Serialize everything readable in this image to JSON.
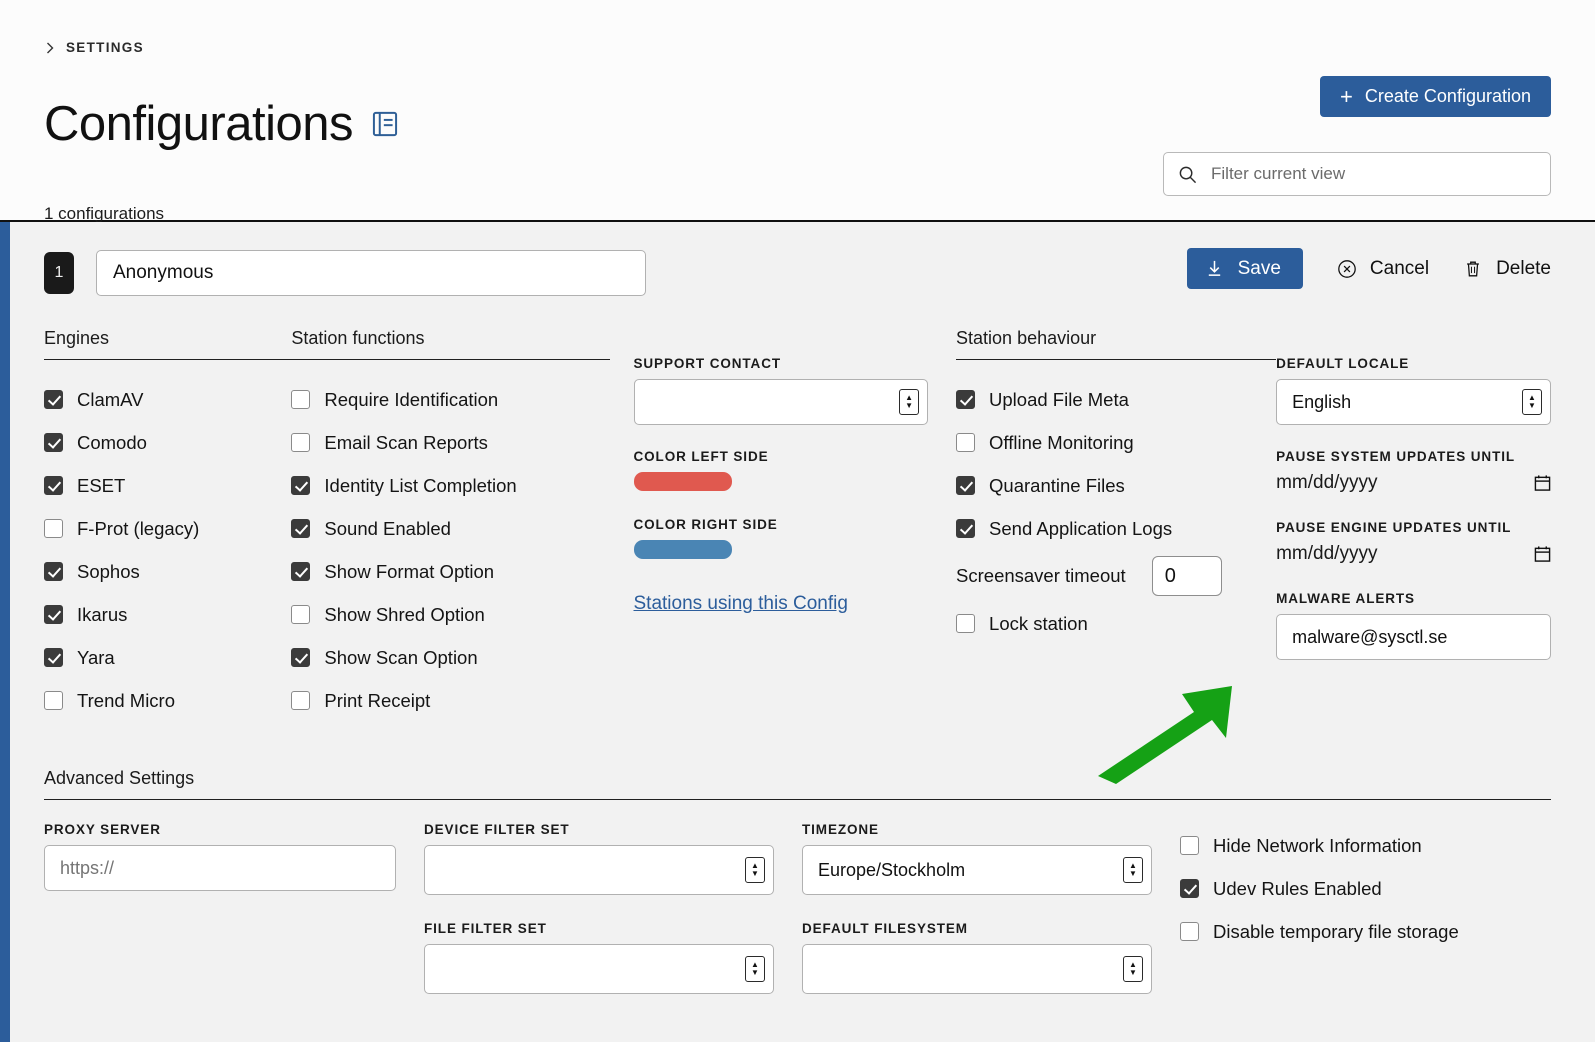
{
  "header": {
    "breadcrumb": "SETTINGS",
    "title": "Configurations",
    "title_icon": "book-icon",
    "subtitle": "1 configurations",
    "create_button": "Create Configuration",
    "create_icon": "plus-icon",
    "filter_placeholder": "Filter current view",
    "filter_value": "",
    "search_icon": "search-icon",
    "accent_color": "#2c5d9b"
  },
  "config": {
    "index": "1",
    "name": "Anonymous",
    "save_label": "Save",
    "save_icon": "download-icon",
    "cancel_label": "Cancel",
    "cancel_icon": "circle-x-icon",
    "delete_label": "Delete",
    "delete_icon": "trash-icon"
  },
  "engines": {
    "heading": "Engines",
    "items": [
      {
        "label": "ClamAV",
        "checked": true
      },
      {
        "label": "Comodo",
        "checked": true
      },
      {
        "label": "ESET",
        "checked": true
      },
      {
        "label": "F-Prot (legacy)",
        "checked": false
      },
      {
        "label": "Sophos",
        "checked": true
      },
      {
        "label": "Ikarus",
        "checked": true
      },
      {
        "label": "Yara",
        "checked": true
      },
      {
        "label": "Trend Micro",
        "checked": false
      }
    ]
  },
  "station_functions": {
    "heading": "Station functions",
    "items": [
      {
        "label": "Require Identification",
        "checked": false
      },
      {
        "label": "Email Scan Reports",
        "checked": false
      },
      {
        "label": "Identity List Completion",
        "checked": true
      },
      {
        "label": "Sound Enabled",
        "checked": true
      },
      {
        "label": "Show Format Option",
        "checked": true
      },
      {
        "label": "Show Shred Option",
        "checked": false
      },
      {
        "label": "Show Scan Option",
        "checked": true
      },
      {
        "label": "Print Receipt",
        "checked": false
      }
    ]
  },
  "support": {
    "contact_label": "SUPPORT CONTACT",
    "contact_value": "",
    "color_left_label": "COLOR LEFT SIDE",
    "color_left_value": "#e0594f",
    "color_right_label": "COLOR RIGHT SIDE",
    "color_right_value": "#4a85b4",
    "stations_link": "Stations using this Config"
  },
  "station_behaviour": {
    "heading": "Station behaviour",
    "items": [
      {
        "label": "Upload File Meta",
        "checked": true
      },
      {
        "label": "Offline Monitoring",
        "checked": false
      },
      {
        "label": "Quarantine Files",
        "checked": true
      },
      {
        "label": "Send Application Logs",
        "checked": true
      }
    ],
    "screensaver_label": "Screensaver timeout",
    "screensaver_value": "0",
    "lock_label": "Lock station",
    "lock_checked": false
  },
  "locale_panel": {
    "default_locale_label": "DEFAULT LOCALE",
    "default_locale_value": "English",
    "pause_system_label": "PAUSE SYSTEM UPDATES UNTIL",
    "pause_system_value": "mm/dd/yyyy",
    "pause_engine_label": "PAUSE ENGINE UPDATES UNTIL",
    "pause_engine_value": "mm/dd/yyyy",
    "malware_alerts_label": "MALWARE ALERTS",
    "malware_alerts_value": "malware@sysctl.se",
    "calendar_icon": "calendar-icon"
  },
  "advanced": {
    "heading": "Advanced Settings",
    "proxy_label": "PROXY SERVER",
    "proxy_placeholder": "https://",
    "proxy_value": "",
    "device_filter_label": "DEVICE FILTER SET",
    "device_filter_value": "",
    "file_filter_label": "FILE FILTER SET",
    "file_filter_value": "",
    "timezone_label": "TIMEZONE",
    "timezone_value": "Europe/Stockholm",
    "default_fs_label": "DEFAULT FILESYSTEM",
    "default_fs_value": "",
    "toggles": [
      {
        "label": "Hide Network Information",
        "checked": false
      },
      {
        "label": "Udev Rules Enabled",
        "checked": true
      },
      {
        "label": "Disable temporary file storage",
        "checked": false
      }
    ]
  },
  "annotation": {
    "arrow_icon": "green-arrow-icon",
    "arrow_color": "#15a115"
  }
}
